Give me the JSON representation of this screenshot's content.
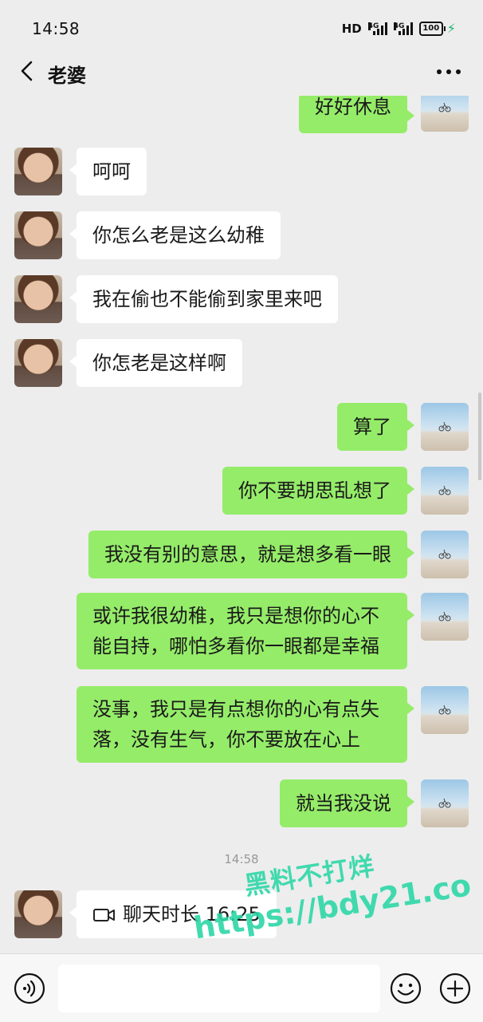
{
  "status_bar": {
    "time": "14:58",
    "network_label": "HD",
    "signal1_label": "4G",
    "signal2_label": "4G",
    "battery": "100"
  },
  "header": {
    "title": "老婆",
    "back_icon": "chevron-left-icon",
    "more_icon": "more-horizontal-icon"
  },
  "messages": [
    {
      "side": "right",
      "text": "好好休息"
    },
    {
      "side": "left",
      "text": "呵呵"
    },
    {
      "side": "left",
      "text": "你怎么老是这么幼稚"
    },
    {
      "side": "left",
      "text": "我在偷也不能偷到家里来吧"
    },
    {
      "side": "left",
      "text": "你怎老是这样啊"
    },
    {
      "side": "right",
      "text": "算了"
    },
    {
      "side": "right",
      "text": "你不要胡思乱想了"
    },
    {
      "side": "right",
      "text": "我没有别的意思，就是想多看一眼"
    },
    {
      "side": "right",
      "text": "或许我很幼稚，我只是想你的心不能自持，哪怕多看你一眼都是幸福"
    },
    {
      "side": "right",
      "text": "没事，我只是有点想你的心有点失落，没有生气，你不要放在心上"
    },
    {
      "side": "right",
      "text": "就当我没说"
    },
    {
      "side": "left",
      "text": "聊天时长 16:25",
      "icon": "video-call-icon"
    }
  ],
  "timestamp": "14:58",
  "watermark": {
    "line1": "黑料不打烊",
    "line2": "https://bdy21.co"
  },
  "input_bar": {
    "voice_icon": "voice-icon",
    "emoji_icon": "emoji-icon",
    "plus_icon": "plus-icon",
    "placeholder": ""
  },
  "colors": {
    "background": "#ededed",
    "sent_bubble": "#95ec69",
    "received_bubble": "#ffffff",
    "watermark": "#2cd6a6"
  }
}
